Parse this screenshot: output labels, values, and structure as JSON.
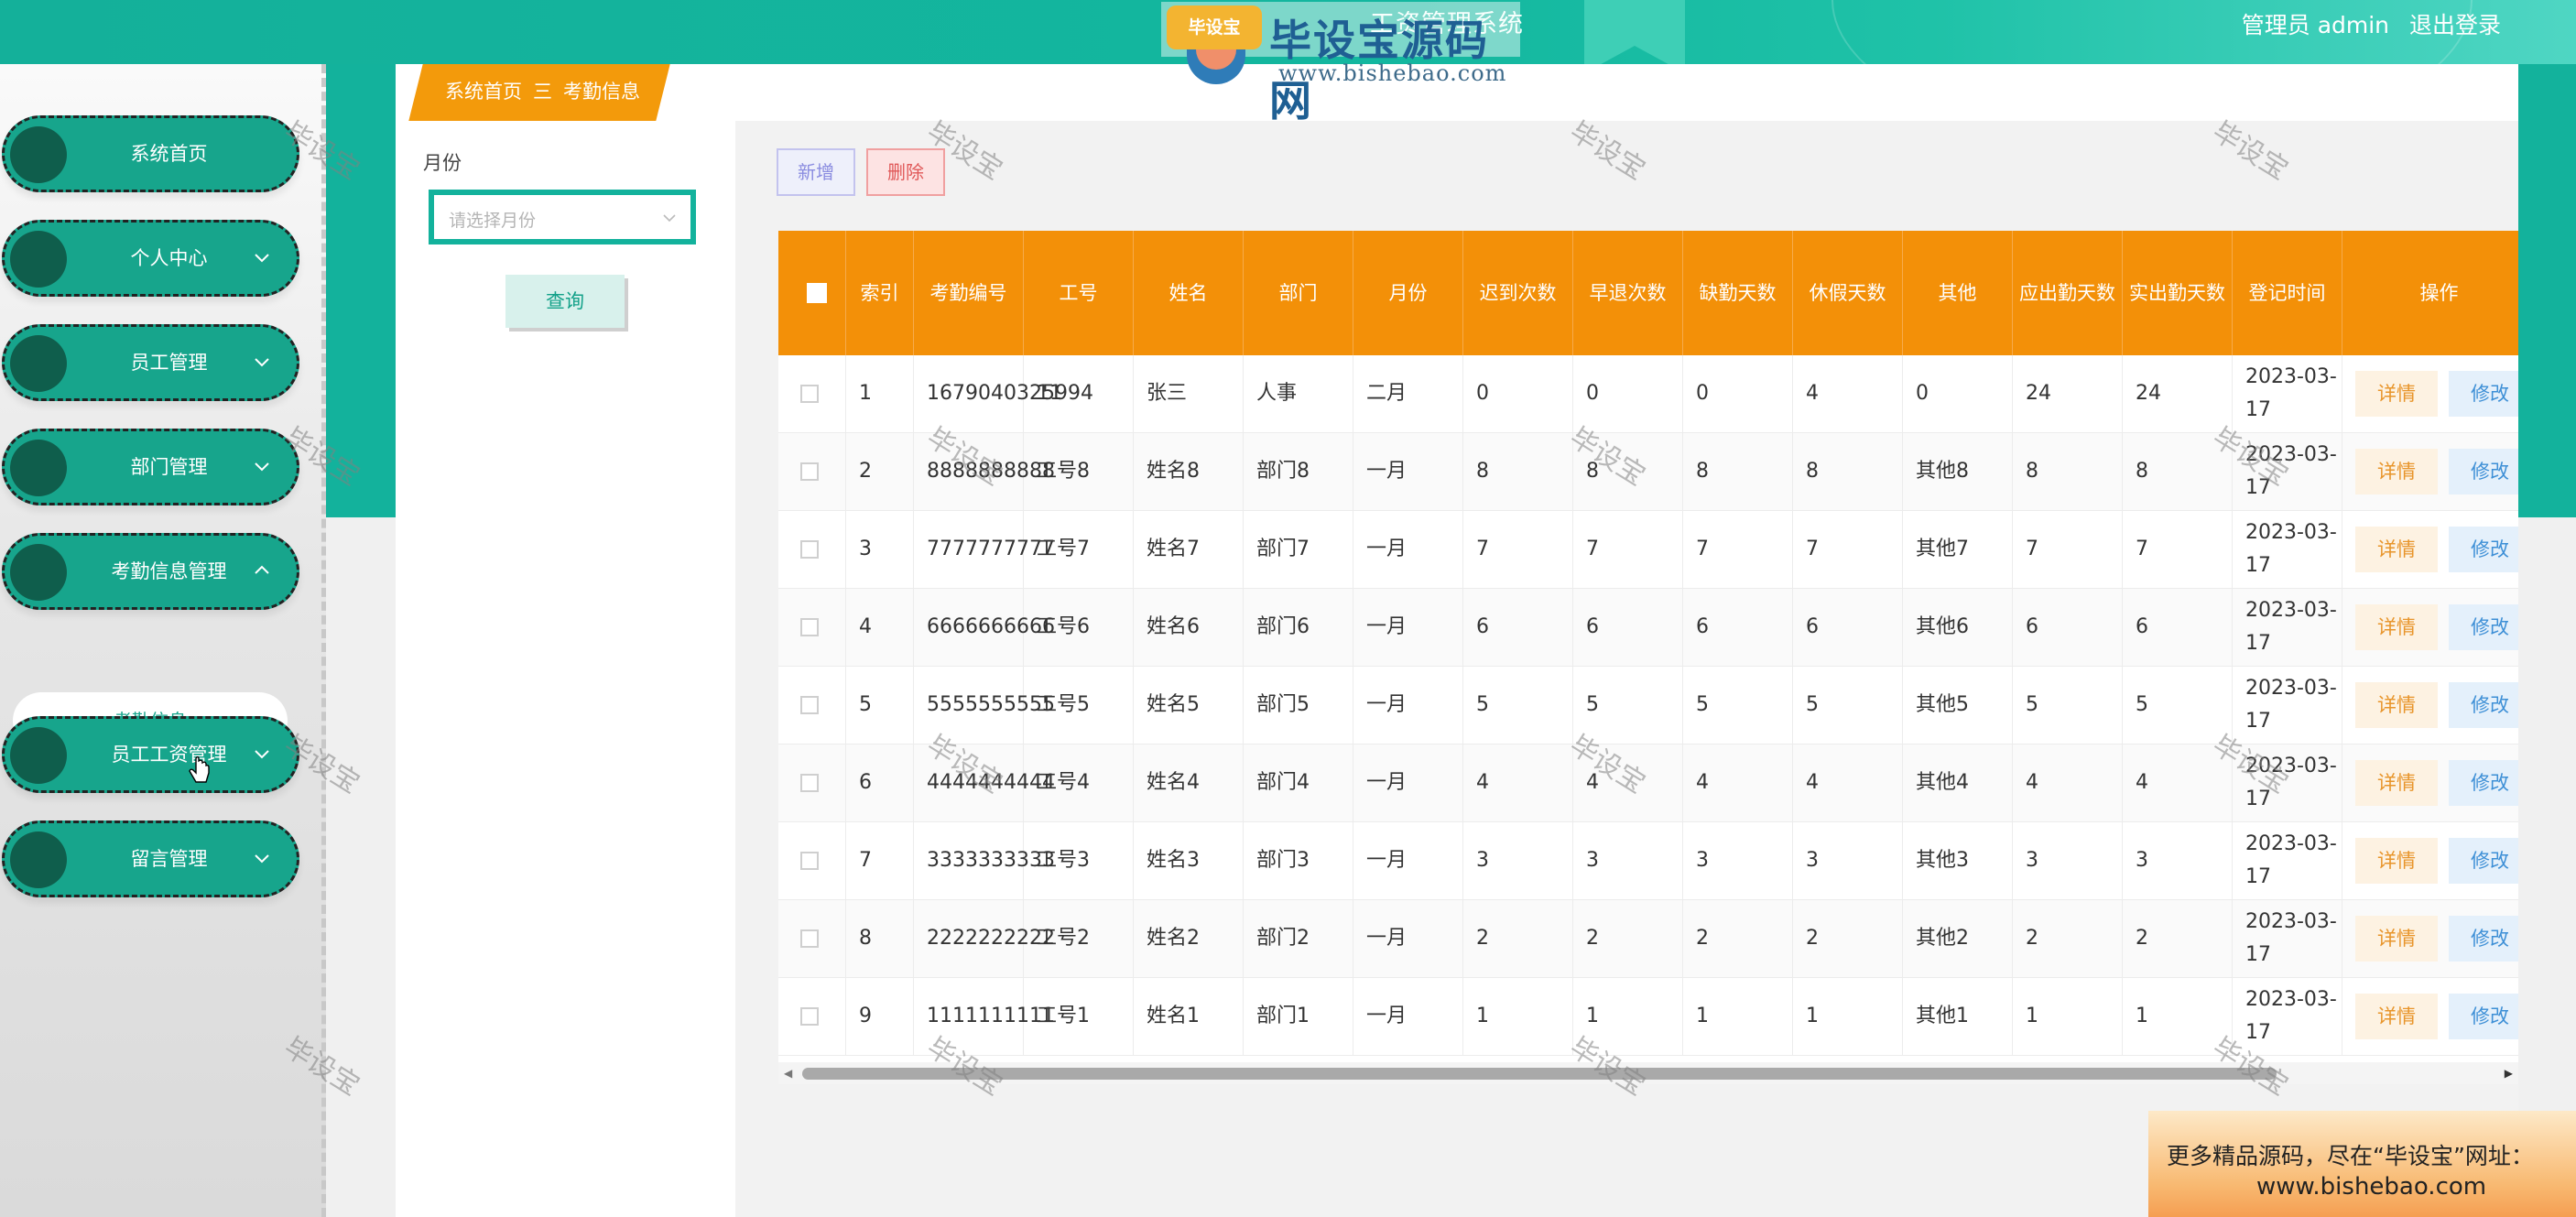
{
  "header": {
    "title": "工资管理系统",
    "user_label": "管理员 admin",
    "logout_label": "退出登录"
  },
  "watermark": {
    "brand": "毕设宝源码网",
    "badge": "毕设宝",
    "url": "www.bishebao.com",
    "text": "毕设宝"
  },
  "sidebar": {
    "items": [
      {
        "label": "系统首页"
      },
      {
        "label": "个人中心"
      },
      {
        "label": "员工管理"
      },
      {
        "label": "部门管理"
      },
      {
        "label": "考勤信息管理"
      },
      {
        "label": "员工工资管理"
      },
      {
        "label": "留言管理"
      }
    ],
    "sub_item": "考勤信息"
  },
  "breadcrumb": {
    "home": "系统首页",
    "separator": "三",
    "current": "考勤信息"
  },
  "search": {
    "month_label": "月份",
    "month_placeholder": "请选择月份",
    "query_button": "查询"
  },
  "actions": {
    "add": "新增",
    "delete": "删除"
  },
  "table": {
    "headers": [
      "索引",
      "考勤编号",
      "工号",
      "姓名",
      "部门",
      "月份",
      "迟到次数",
      "早退次数",
      "缺勤天数",
      "休假天数",
      "其他",
      "应出勤天数",
      "实出勤天数",
      "登记时间",
      "操作"
    ],
    "detail_label": "详情",
    "edit_label": "修改",
    "rows": [
      {
        "idx": "1",
        "code": "1679040325994",
        "emp_no": "11",
        "name": "张三",
        "dept": "人事",
        "month": "二月",
        "late": "0",
        "early": "0",
        "absent": "0",
        "leave": "4",
        "other": "0",
        "due": "24",
        "actual": "24",
        "time": "2023-03-17"
      },
      {
        "idx": "2",
        "code": "8888888888",
        "emp_no": "工号8",
        "name": "姓名8",
        "dept": "部门8",
        "month": "一月",
        "late": "8",
        "early": "8",
        "absent": "8",
        "leave": "8",
        "other": "其他8",
        "due": "8",
        "actual": "8",
        "time": "2023-03-17"
      },
      {
        "idx": "3",
        "code": "7777777777",
        "emp_no": "工号7",
        "name": "姓名7",
        "dept": "部门7",
        "month": "一月",
        "late": "7",
        "early": "7",
        "absent": "7",
        "leave": "7",
        "other": "其他7",
        "due": "7",
        "actual": "7",
        "time": "2023-03-17"
      },
      {
        "idx": "4",
        "code": "6666666666",
        "emp_no": "工号6",
        "name": "姓名6",
        "dept": "部门6",
        "month": "一月",
        "late": "6",
        "early": "6",
        "absent": "6",
        "leave": "6",
        "other": "其他6",
        "due": "6",
        "actual": "6",
        "time": "2023-03-17"
      },
      {
        "idx": "5",
        "code": "5555555555",
        "emp_no": "工号5",
        "name": "姓名5",
        "dept": "部门5",
        "month": "一月",
        "late": "5",
        "early": "5",
        "absent": "5",
        "leave": "5",
        "other": "其他5",
        "due": "5",
        "actual": "5",
        "time": "2023-03-17"
      },
      {
        "idx": "6",
        "code": "4444444444",
        "emp_no": "工号4",
        "name": "姓名4",
        "dept": "部门4",
        "month": "一月",
        "late": "4",
        "early": "4",
        "absent": "4",
        "leave": "4",
        "other": "其他4",
        "due": "4",
        "actual": "4",
        "time": "2023-03-17"
      },
      {
        "idx": "7",
        "code": "3333333333",
        "emp_no": "工号3",
        "name": "姓名3",
        "dept": "部门3",
        "month": "一月",
        "late": "3",
        "early": "3",
        "absent": "3",
        "leave": "3",
        "other": "其他3",
        "due": "3",
        "actual": "3",
        "time": "2023-03-17"
      },
      {
        "idx": "8",
        "code": "2222222222",
        "emp_no": "工号2",
        "name": "姓名2",
        "dept": "部门2",
        "month": "一月",
        "late": "2",
        "early": "2",
        "absent": "2",
        "leave": "2",
        "other": "其他2",
        "due": "2",
        "actual": "2",
        "time": "2023-03-17"
      },
      {
        "idx": "9",
        "code": "1111111111",
        "emp_no": "工号1",
        "name": "姓名1",
        "dept": "部门1",
        "month": "一月",
        "late": "1",
        "early": "1",
        "absent": "1",
        "leave": "1",
        "other": "其他1",
        "due": "1",
        "actual": "1",
        "time": "2023-03-17"
      }
    ]
  },
  "promo": {
    "line1": "更多精品源码，尽在“毕设宝”网址：",
    "line2": "www.bishebao.com"
  },
  "colors": {
    "teal": "#13b29c",
    "orange_header": "#f39008",
    "breadcrumb": "#f39a0b"
  }
}
